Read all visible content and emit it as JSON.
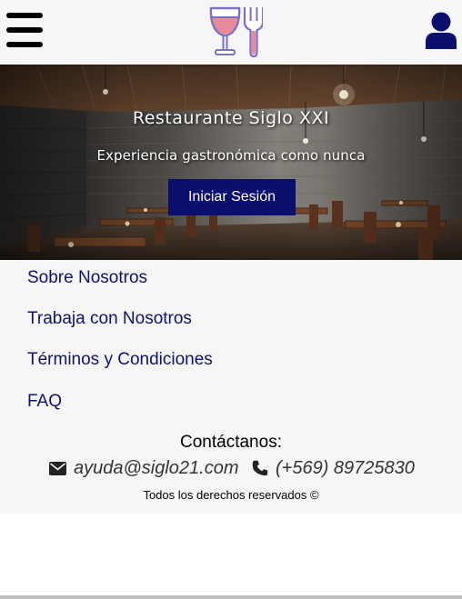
{
  "header": {
    "menu_icon": "hamburger-menu-icon",
    "logo_icon": "wine-glass-and-fork-icon",
    "user_icon": "user-icon"
  },
  "hero": {
    "title": "Restaurante Siglo XXI",
    "subtitle": "Experiencia gastronómica como nunca",
    "login_label": "Iniciar Sesión"
  },
  "footer": {
    "links": [
      "Sobre Nosotros",
      "Trabaja con Nosotros",
      "Términos y Condiciones",
      "FAQ"
    ],
    "contact_title": "Contáctanos:",
    "email": "ayuda@siglo21.com",
    "phone": "(+569) 89725830",
    "copyright": "Todos los derechos reservados ©"
  },
  "colors": {
    "brand_navy": "#0a0f6e",
    "link_navy": "#0d1270",
    "header_bg": "#f6f6f6",
    "logo_wine": "#e88a9a",
    "logo_outline": "#7b6fc4"
  }
}
